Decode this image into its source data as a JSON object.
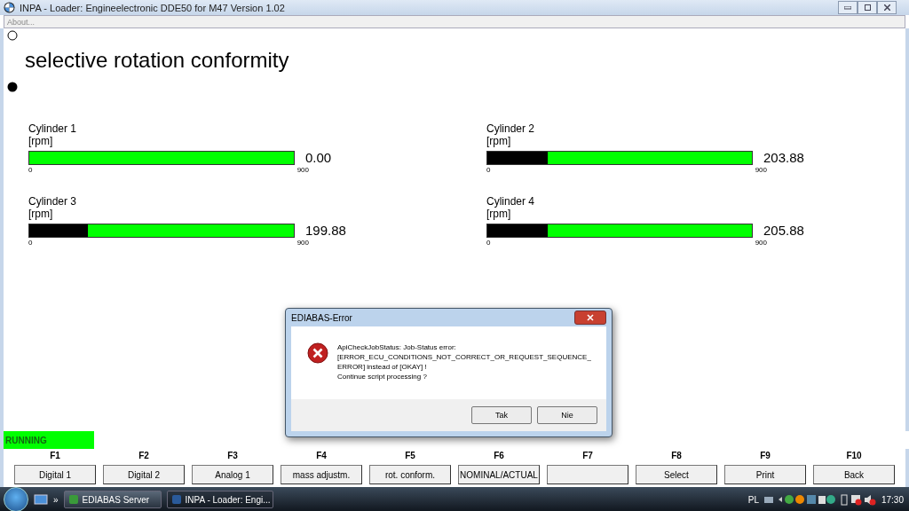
{
  "window": {
    "title": "INPA - Loader:  Engineelectronic DDE50 for M47 Version 1.02"
  },
  "menu": [
    "About..."
  ],
  "screen": {
    "title": "selective rotation conformity",
    "gauges": [
      {
        "name": "Cylinder 1",
        "unit": "[rpm]",
        "min": "0",
        "max": "900",
        "reading": "0.00",
        "level": 0
      },
      {
        "name": "Cylinder 2",
        "unit": "[rpm]",
        "min": "0",
        "max": "900",
        "reading": "203.88",
        "level": 0.227
      },
      {
        "name": "Cylinder 3",
        "unit": "[rpm]",
        "min": "0",
        "max": "900",
        "reading": "199.88",
        "level": 0.222
      },
      {
        "name": "Cylinder 4",
        "unit": "[rpm]",
        "min": "0",
        "max": "900",
        "reading": "205.88",
        "level": 0.229
      }
    ]
  },
  "status": "RUNNING",
  "function_keys": [
    {
      "key": "F1",
      "label": "Digital 1"
    },
    {
      "key": "F2",
      "label": "Digital 2"
    },
    {
      "key": "F3",
      "label": "Analog 1"
    },
    {
      "key": "F4",
      "label": "mass adjustm."
    },
    {
      "key": "F5",
      "label": "rot. conform."
    },
    {
      "key": "F6",
      "label": "NOMINAL/ACTUAL"
    },
    {
      "key": "F7"
    },
    {
      "key": "F8",
      "label": "Select"
    },
    {
      "key": "F9",
      "label": "Print"
    },
    {
      "key": "F10",
      "label": "Back"
    }
  ],
  "dialog": {
    "title": "EDIABAS-Error",
    "message_lines": [
      "ApiCheckJobStatus: Job-Status error:",
      "[ERROR_ECU_CONDITIONS_NOT_CORRECT_OR_REQUEST_SEQUENCE_",
      "ERROR] instead of [OKAY] !",
      "Continue script processing ?"
    ],
    "buttons": [
      "Tak",
      "Nie"
    ]
  },
  "taskbar": {
    "overflow": "»",
    "tasks": [
      {
        "label": "EDIABAS Server",
        "selected": false
      },
      {
        "label": "INPA - Loader:  Engi...",
        "selected": true
      }
    ],
    "language": "PL",
    "clock": "17:30"
  }
}
